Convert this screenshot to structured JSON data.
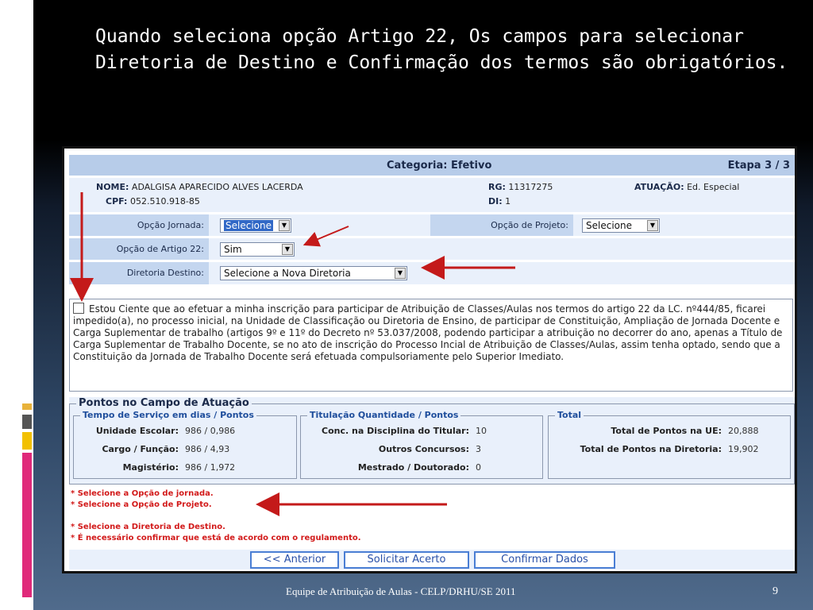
{
  "slide": {
    "title": "Quando seleciona opção Artigo 22, Os campos para selecionar Diretoria de Destino e Confirmação dos termos são obrigatórios.",
    "footer": "Equipe de Atribuição de Aulas - CELP/DRHU/SE  2011",
    "page_number": "9"
  },
  "form": {
    "categoria": "Categoria: Efetivo",
    "etapa": "Etapa 3 / 3",
    "nome_label": "NOME:",
    "nome": "ADALGISA APARECIDO ALVES LACERDA",
    "cpf_label": "CPF:",
    "cpf": "052.510.918-85",
    "rg_label": "RG:",
    "rg": "11317275",
    "di_label": "DI:",
    "di": "1",
    "atuacao_label": "ATUAÇÃO:",
    "atuacao": "Ed. Especial",
    "opcao_jornada_label": "Opção Jornada:",
    "opcao_jornada_value": "Selecione",
    "opcao_projeto_label": "Opção de Projeto:",
    "opcao_projeto_value": "Selecione",
    "opcao_artigo_label": "Opção de Artigo 22:",
    "opcao_artigo_value": "Sim",
    "diretoria_label": "Diretoria Destino:",
    "diretoria_value": "Selecione a Nova Diretoria",
    "terms_text": "Estou Ciente que ao efetuar a minha inscrição para participar de Atribuição de Classes/Aulas nos termos do artigo 22 da LC. nº444/85, ficarei impedido(a), no processo inicial, na Unidade de Classificação ou Diretoria de Ensino, de participar de Constituição, Ampliação de Jornada Docente e Carga Suplementar de trabalho (artigos 9º e 11º do Decreto nº 53.037/2008, podendo participar a atribuição no decorrer do ano, apenas a Título de Carga Suplementar de Trabalho Docente, se no ato de inscrição do Processo Incial de Atribuição de Classes/Aulas, assim tenha optado, sendo que a Constituição da Jornada de Trabalho Docente será efetuada compulsoriamente pelo Superior Imediato."
  },
  "pontos": {
    "title": "Pontos no Campo de Atuação",
    "tempo": {
      "legend": "Tempo de Serviço em dias / Pontos",
      "rows": [
        {
          "k": "Unidade Escolar:",
          "v": "986 / 0,986"
        },
        {
          "k": "Cargo / Função:",
          "v": "986 / 4,93"
        },
        {
          "k": "Magistério:",
          "v": "986 / 1,972"
        }
      ]
    },
    "titulacao": {
      "legend": "Titulação Quantidade / Pontos",
      "rows": [
        {
          "k": "Conc. na Disciplina do Titular:",
          "v": "10"
        },
        {
          "k": "Outros Concursos:",
          "v": "3"
        },
        {
          "k": "Mestrado / Doutorado:",
          "v": "0"
        }
      ]
    },
    "total": {
      "legend": "Total",
      "rows": [
        {
          "k": "Total de Pontos na UE:",
          "v": "20,888"
        },
        {
          "k": "Total de Pontos na Diretoria:",
          "v": "19,902"
        }
      ]
    }
  },
  "messages": [
    "* Selecione a Opção de jornada.",
    "* Selecione a Opção de Projeto.",
    "* Selecione a Diretoria de Destino.",
    "* É necessário confirmar que está de acordo com o regulamento."
  ],
  "buttons": {
    "anterior": "<< Anterior",
    "solicitar": "Solicitar Acerto",
    "confirmar": "Confirmar Dados"
  },
  "colors": {
    "accent_red": "#c41a1a",
    "header_blue": "#b7cce9",
    "panel_blue": "#e9f0fb"
  }
}
